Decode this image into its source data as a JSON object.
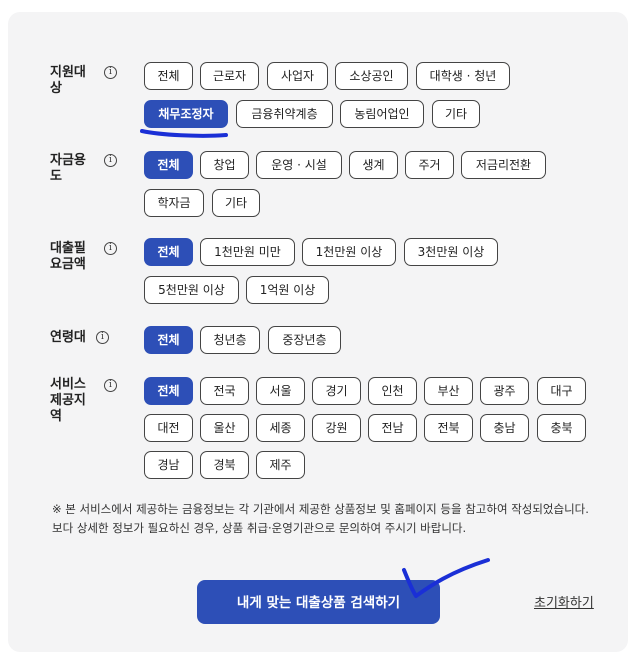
{
  "filters": [
    {
      "label": "지원대상",
      "options": [
        "전체",
        "근로자",
        "사업자",
        "소상공인",
        "대학생 · 청년",
        "채무조정자",
        "금융취약계층",
        "농림어업인",
        "기타"
      ],
      "selected": "채무조정자"
    },
    {
      "label": "자금용도",
      "options": [
        "전체",
        "창업",
        "운영 · 시설",
        "생계",
        "주거",
        "저금리전환",
        "학자금",
        "기타"
      ],
      "selected": "전체"
    },
    {
      "label": "대출필요금액",
      "options": [
        "전체",
        "1천만원 미만",
        "1천만원 이상",
        "3천만원 이상",
        "5천만원 이상",
        "1억원 이상"
      ],
      "selected": "전체"
    },
    {
      "label": "연령대",
      "options": [
        "전체",
        "청년층",
        "중장년층"
      ],
      "selected": "전체"
    },
    {
      "label": "서비스제공지역",
      "options": [
        "전체",
        "전국",
        "서울",
        "경기",
        "인천",
        "부산",
        "광주",
        "대구",
        "대전",
        "울산",
        "세종",
        "강원",
        "전남",
        "전북",
        "충남",
        "충북",
        "경남",
        "경북",
        "제주"
      ],
      "selected": "전체"
    }
  ],
  "info_icon": "i",
  "notice": {
    "line1": "※ 본 서비스에서 제공하는 금융정보는 각 기관에서 제공한 상품정보 및 홈페이지 등을 참고하여 작성되었습니다.",
    "line2": "보다 상세한 정보가 필요하신 경우, 상품 취급·운영기관으로 문의하여 주시기 바랍니다."
  },
  "actions": {
    "search_label": "내게 맞는 대출상품 검색하기",
    "reset_label": "초기화하기"
  },
  "colors": {
    "accent": "#2d4fb7",
    "panel": "#f4f4f5",
    "annotation": "#1a2fd6"
  }
}
